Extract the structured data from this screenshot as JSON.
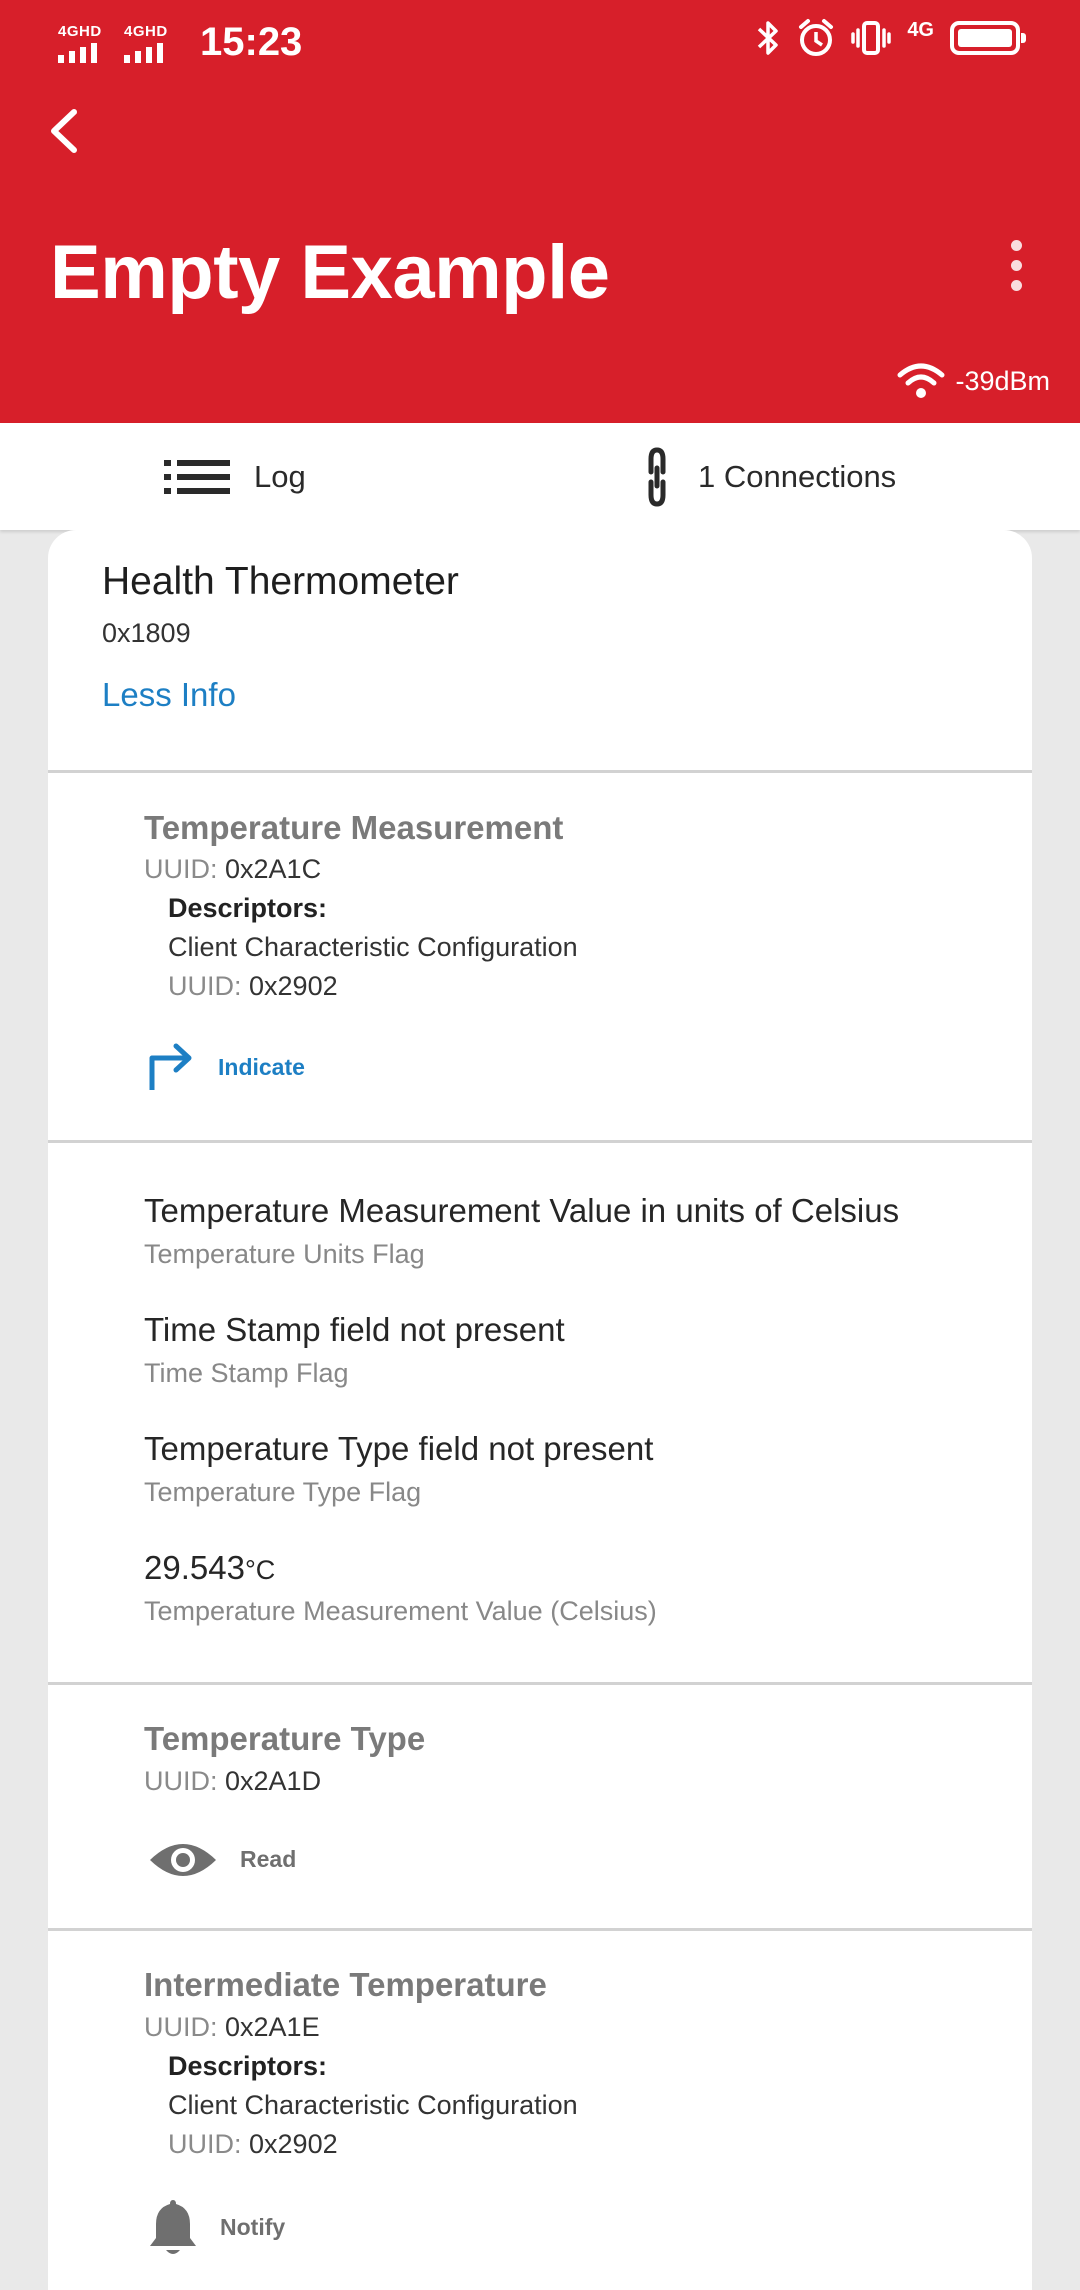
{
  "status_bar": {
    "sim1": "4GHD",
    "sim2": "4GHD",
    "time": "15:23",
    "network": "4G",
    "icons": [
      "bluetooth-icon",
      "alarm-icon",
      "vibrate-icon",
      "battery-icon"
    ]
  },
  "app_bar": {
    "title": "Empty Example",
    "rssi": "-39dBm",
    "colors": {
      "background": "#d71f2a",
      "text": "#ffffff"
    }
  },
  "tabs": [
    {
      "label": "Log",
      "icon": "list-icon"
    },
    {
      "label": "1 Connections",
      "icon": "link-icon"
    }
  ],
  "service": {
    "name": "Health Thermometer",
    "uuid": "0x1809",
    "toggle_label": "Less Info"
  },
  "characteristics": {
    "temp_measurement": {
      "title": "Temperature Measurement",
      "uuid_key": "UUID:",
      "uuid": "0x2A1C",
      "descriptors_heading": "Descriptors:",
      "descriptor_name": "Client Characteristic Configuration",
      "descriptor_uuid_key": "UUID:",
      "descriptor_uuid": "0x2902",
      "property": "Indicate"
    },
    "temp_values": {
      "units_value": "Temperature Measurement Value in units of Celsius",
      "units_label": "Temperature Units Flag",
      "timestamp_value": "Time Stamp field not present",
      "timestamp_label": "Time Stamp Flag",
      "type_value": "Temperature Type field not present",
      "type_label": "Temperature Type Flag",
      "measurement_value": "29.543",
      "measurement_unit": "°C",
      "measurement_label": "Temperature Measurement Value (Celsius)"
    },
    "temp_type": {
      "title": "Temperature Type",
      "uuid_key": "UUID:",
      "uuid": "0x2A1D",
      "property": "Read"
    },
    "intermediate_temp": {
      "title": "Intermediate Temperature",
      "uuid_key": "UUID:",
      "uuid": "0x2A1E",
      "descriptors_heading": "Descriptors:",
      "descriptor_name": "Client Characteristic Configuration",
      "descriptor_uuid_key": "UUID:",
      "descriptor_uuid": "0x2902",
      "property": "Notify"
    }
  },
  "colors": {
    "accent_blue": "#1d7fc4",
    "muted_gray": "#7a7a7a"
  }
}
